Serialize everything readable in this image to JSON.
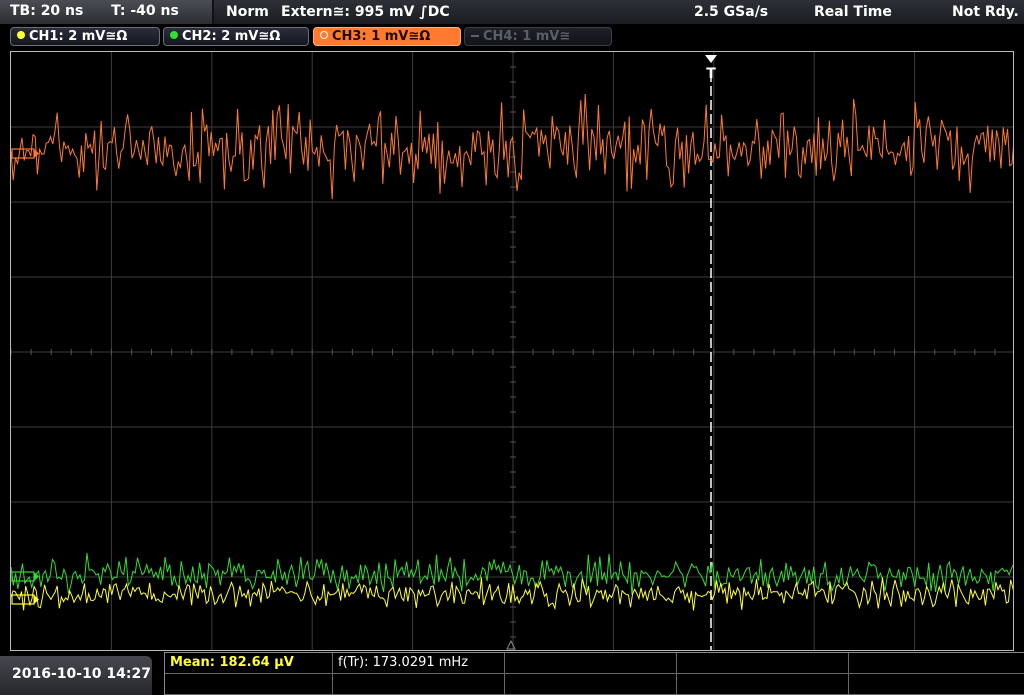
{
  "status": {
    "timebase": "TB: 20 ns",
    "trigger_offset": "T: -40 ns",
    "trigger_mode": "Norm",
    "trigger_source": "Extern≅: 995 mV ∫DC",
    "sample_rate": "2.5 GSa/s",
    "acq_mode": "Real Time",
    "state": "Not Rdy."
  },
  "channels": [
    {
      "label": "CH1: 2 mV≅Ω",
      "color": "#ffff33",
      "active": false
    },
    {
      "label": "CH2: 2 mV≅Ω",
      "color": "#33dd33",
      "active": false
    },
    {
      "label": "CH3: 1 mV≅Ω",
      "color": "#ff7a2e",
      "active": true
    },
    {
      "label": "CH4: 1 mV≅",
      "color": "#5b5e66",
      "active": false
    }
  ],
  "trigger_marker": "T",
  "footer": {
    "datetime": "2016-10-10 14:27",
    "mean": "Mean: 182.64 µV",
    "freq": "f(Tr): 173.0291 mHz"
  },
  "colors": {
    "ch1": "#ffff33",
    "ch2": "#33dd33",
    "ch3": "#ff7a2e",
    "grid": "#3c3c3c",
    "mean_text": "#ffff33"
  }
}
